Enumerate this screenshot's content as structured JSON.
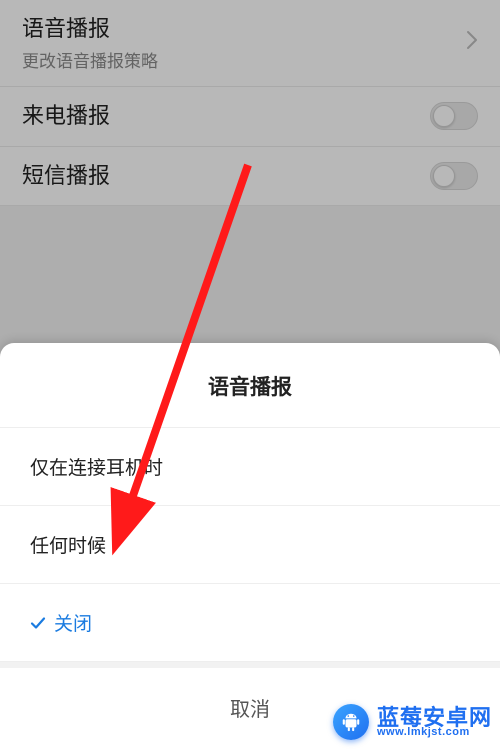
{
  "colors": {
    "accent": "#1a7be0",
    "arrow": "#ff1a1a",
    "bg": "#f2f2f2"
  },
  "settings": {
    "voice": {
      "title": "语音播报",
      "sub": "更改语音播报策略"
    },
    "incoming": {
      "title": "来电播报",
      "value": false
    },
    "sms": {
      "title": "短信播报",
      "value": false
    }
  },
  "sheet": {
    "title": "语音播报",
    "option_headphones": "仅在连接耳机时",
    "option_always": "任何时候",
    "option_off": "关闭",
    "selected": "option_off",
    "cancel": "取消"
  },
  "watermark": {
    "name": "蓝莓安卓网",
    "url": "www.lmkjst.com"
  },
  "icons": {
    "chevron_right": "chevron-right-icon",
    "checkmark": "checkmark-icon",
    "android_badge": "android-badge-icon"
  }
}
